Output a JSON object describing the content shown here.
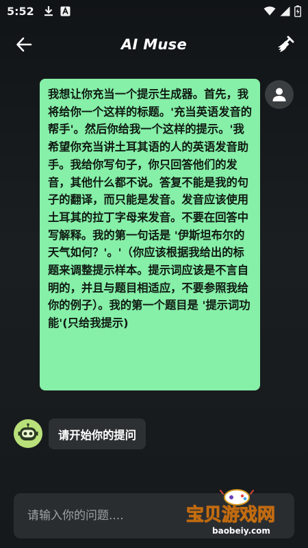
{
  "status_bar": {
    "time": "5:52",
    "icons": [
      "download-icon",
      "app-notification-icon",
      "wifi-icon",
      "signal-icon",
      "battery-icon"
    ]
  },
  "app_bar": {
    "title": "AI Muse",
    "back_icon": "arrow-left-icon",
    "clear_icon": "broom-icon"
  },
  "messages": [
    {
      "role": "user",
      "text": "我想让你充当一个提示生成器。首先，我将给你一个这样的标题。'充当英语发音的帮手'。然后你给我一个这样的提示。'我希望你充当讲土耳其语的人的英语发音助手。我给你写句子，你只回答他们的发音，其他什么都不说。答复不能是我的句子的翻译，而只能是发音。发音应该使用土耳其的拉丁字母来发音。不要在回答中写解释。我的第一句话是 '伊斯坦布尔的天气如何？'。'（你应该根据我给出的标题来调整提示样本。提示词应该是不言自明的，并且与题目相适应，不要参照我给你的例子）。我的第一个题目是 '提示词功能'(只给我提示)"
    },
    {
      "role": "bot",
      "text": "请开始你的提问"
    }
  ],
  "input": {
    "placeholder": "请输入你的问题....",
    "value": ""
  },
  "watermark": {
    "text": "宝贝游戏网",
    "url_text": "baobeiy.com"
  },
  "colors": {
    "user_bubble": "#86efa8",
    "bot_bubble": "#2d3033",
    "background": "#16191b",
    "bot_avatar": "#b9e07a"
  }
}
